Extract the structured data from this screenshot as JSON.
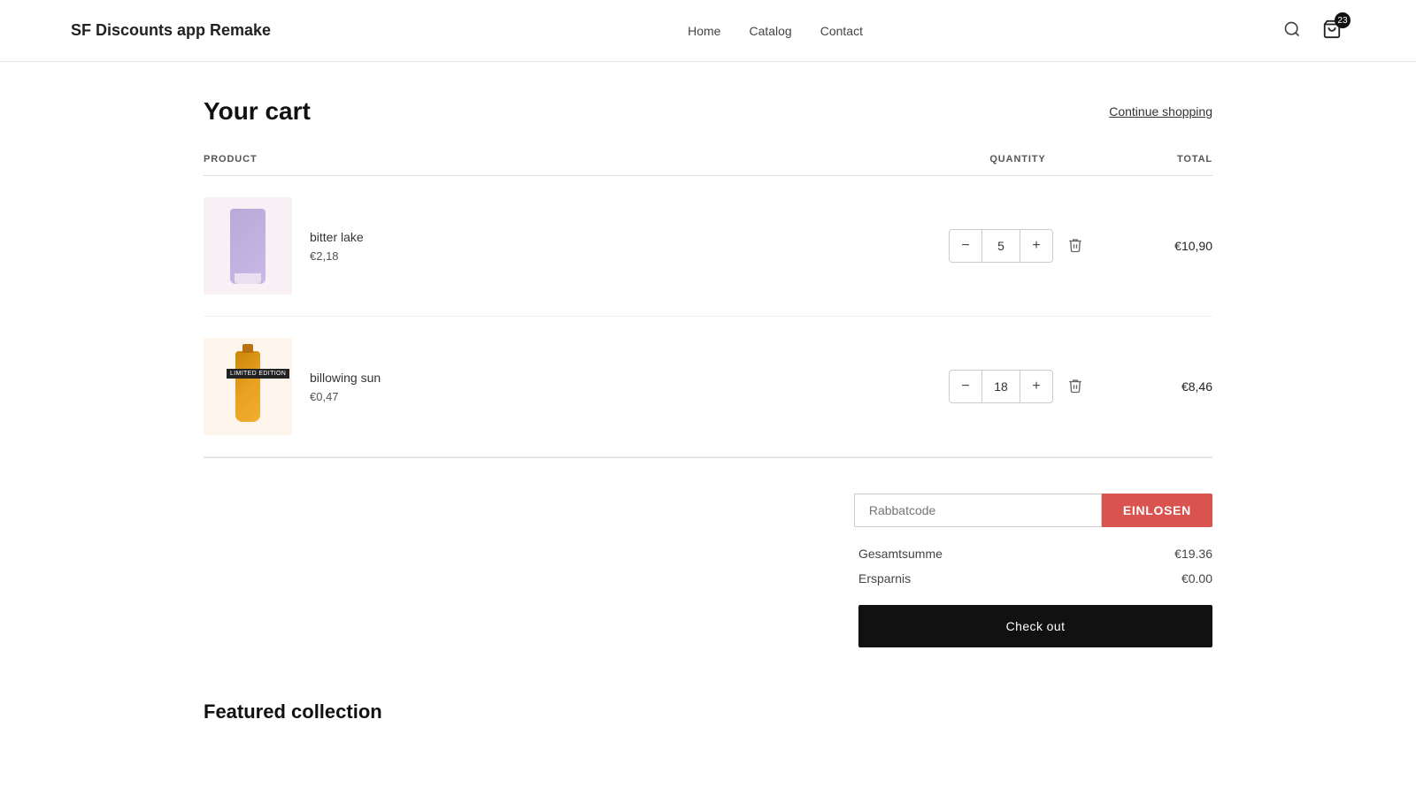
{
  "site": {
    "logo": "SF Discounts app Remake"
  },
  "nav": {
    "items": [
      {
        "label": "Home"
      },
      {
        "label": "Catalog"
      },
      {
        "label": "Contact"
      }
    ]
  },
  "cart_icon": {
    "badge": "23"
  },
  "cart": {
    "title": "Your cart",
    "continue_shopping": "Continue shopping",
    "columns": {
      "product": "PRODUCT",
      "quantity": "QUANTITY",
      "total": "TOTAL"
    },
    "items": [
      {
        "name": "bitter lake",
        "price": "€2,18",
        "quantity": 5,
        "total": "€10,90",
        "image_type": "tube",
        "limited_edition": false
      },
      {
        "name": "billowing sun",
        "price": "€0,47",
        "quantity": 18,
        "total": "€8,46",
        "image_type": "bottle",
        "limited_edition": true
      }
    ],
    "discount": {
      "placeholder": "Rabbatcode",
      "button_label": "EINLOSEN"
    },
    "summary": {
      "subtotal_label": "Gesamtsumme",
      "subtotal_value": "€19.36",
      "savings_label": "Ersparnis",
      "savings_value": "€0.00"
    },
    "checkout_label": "Check out"
  },
  "featured": {
    "title": "Featured collection"
  }
}
